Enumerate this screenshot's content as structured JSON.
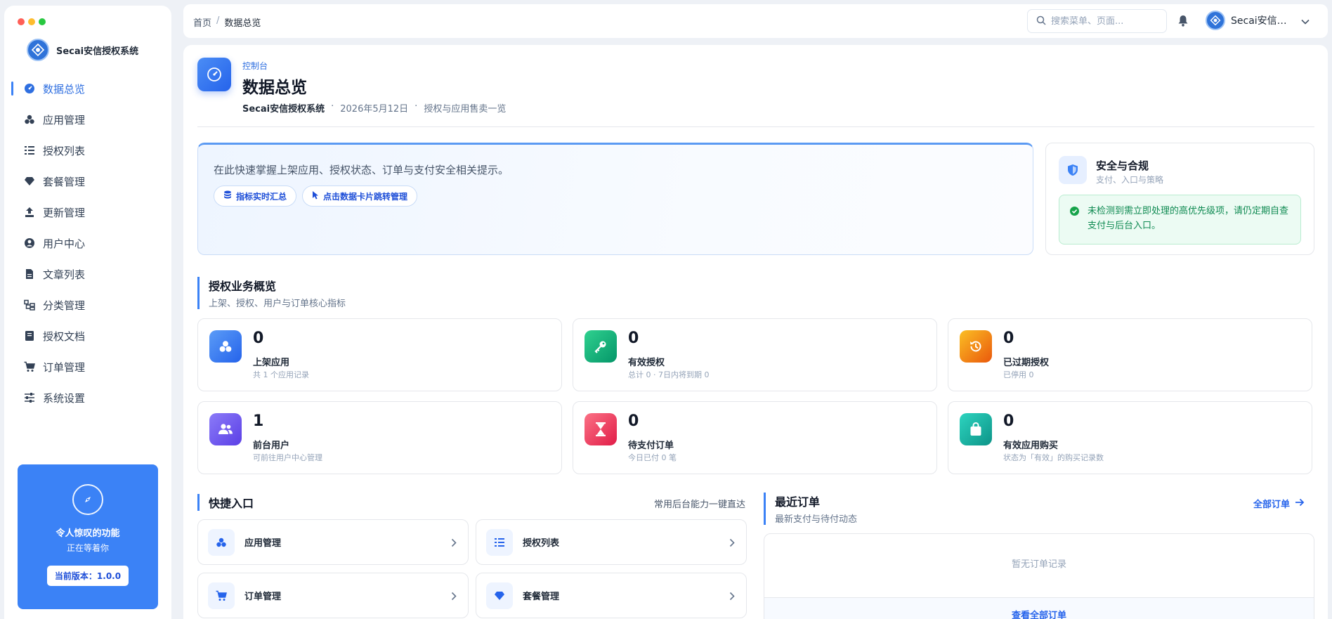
{
  "window": {
    "dot_colors": [
      "#ff5f57",
      "#febc2e",
      "#28c840"
    ]
  },
  "brand": {
    "name": "Secai安信授权系统"
  },
  "sidebar": {
    "items": [
      {
        "label": "数据总览",
        "icon": "dashboard-icon",
        "active": true
      },
      {
        "label": "应用管理",
        "icon": "apps-icon"
      },
      {
        "label": "授权列表",
        "icon": "list-icon"
      },
      {
        "label": "套餐管理",
        "icon": "gem-icon"
      },
      {
        "label": "更新管理",
        "icon": "upload-icon"
      },
      {
        "label": "用户中心",
        "icon": "user-circle-icon"
      },
      {
        "label": "文章列表",
        "icon": "file-icon"
      },
      {
        "label": "分类管理",
        "icon": "category-icon"
      },
      {
        "label": "授权文档",
        "icon": "book-icon"
      },
      {
        "label": "订单管理",
        "icon": "cart-icon"
      },
      {
        "label": "系统设置",
        "icon": "sliders-icon"
      }
    ],
    "promo": {
      "title": "令人惊叹的功能",
      "subtitle": "正在等着你",
      "version_button": "当前版本：1.0.0"
    }
  },
  "topbar": {
    "breadcrumb": {
      "home": "首页",
      "separator": "/",
      "current": "数据总览"
    },
    "search_placeholder": "搜索菜单、页面...",
    "user_name": "Secai安信授权系统"
  },
  "header": {
    "kicker": "控制台",
    "title": "数据总览",
    "meta_system": "Secai安信授权系统",
    "meta_dot": "·",
    "meta_date": "2026年5月12日",
    "meta_desc": "授权与应用售卖一览"
  },
  "intro": {
    "text": "在此快速掌握上架应用、授权状态、订单与支付安全相关提示。",
    "chips": [
      "指标实时汇总",
      "点击数据卡片跳转管理"
    ]
  },
  "security": {
    "title": "安全与合规",
    "subtitle": "支付、入口与策略",
    "alert": "未检测到需立即处理的高优先级项，请仍定期自查支付与后台入口。"
  },
  "overview": {
    "title": "授权业务概览",
    "subtitle": "上架、授权、用户与订单核心指标",
    "stats": [
      {
        "value": "0",
        "label": "上架应用",
        "sub": "共 1 个应用记录",
        "color": "#3b82f6",
        "icon": "apps-icon"
      },
      {
        "value": "0",
        "label": "有效授权",
        "sub": "总计 0 · 7日内将到期 0",
        "color": "#10b981",
        "icon": "key-icon"
      },
      {
        "value": "0",
        "label": "已过期授权",
        "sub": "已停用 0",
        "color": "#f59e0b",
        "icon": "history-icon"
      },
      {
        "value": "1",
        "label": "前台用户",
        "sub": "可前往用户中心管理",
        "color": "#6d5cf5",
        "icon": "users-icon"
      },
      {
        "value": "0",
        "label": "待支付订单",
        "sub": "今日已付 0 笔",
        "color": "#f43f5e",
        "icon": "hourglass-icon"
      },
      {
        "value": "0",
        "label": "有效应用购买",
        "sub": "状态为「有效」的购买记录数",
        "color": "#14b8a6",
        "icon": "bag-icon"
      }
    ]
  },
  "quick": {
    "title": "快捷入口",
    "hint": "常用后台能力一键直达",
    "items": [
      {
        "label": "应用管理",
        "icon": "apps-icon"
      },
      {
        "label": "授权列表",
        "icon": "list-icon"
      },
      {
        "label": "订单管理",
        "icon": "cart-icon"
      },
      {
        "label": "套餐管理",
        "icon": "gem-icon"
      }
    ]
  },
  "orders": {
    "title": "最近订单",
    "subtitle": "最新支付与待付动态",
    "all_link": "全部订单",
    "empty": "暂无订单记录",
    "footer_link": "查看全部订单"
  }
}
